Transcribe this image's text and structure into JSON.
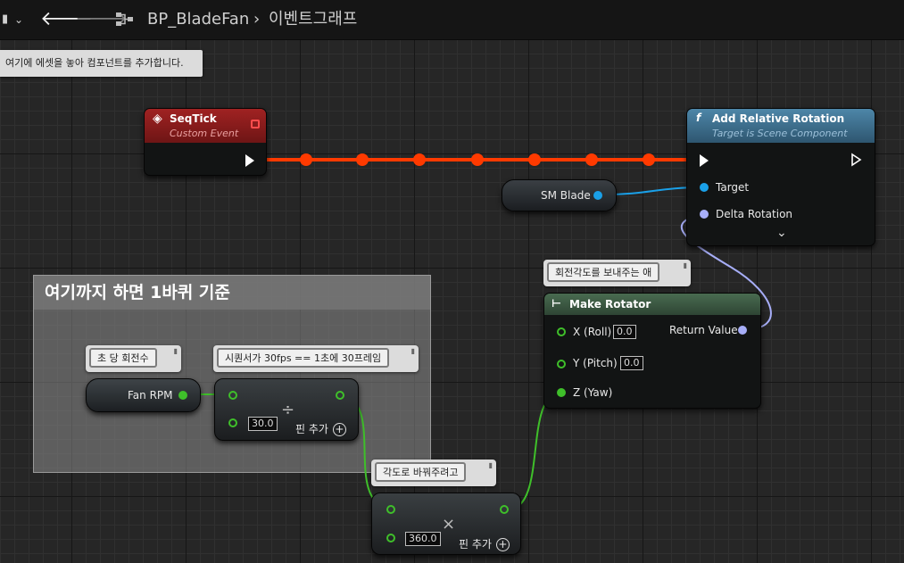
{
  "toolbar": {
    "blueprint_name": "BP_BladeFan",
    "graph_name": "이벤트그래프"
  },
  "tooltip": "여기에 에셋을 놓아 컴포넌트를 추가합니다.",
  "comment": {
    "title": "여기까지 하면 1바퀴 기준"
  },
  "nodes": {
    "seqtick": {
      "title": "SeqTick",
      "subtitle": "Custom Event"
    },
    "add_rotation": {
      "title": "Add Relative Rotation",
      "subtitle": "Target is Scene Component",
      "target_label": "Target",
      "delta_label": "Delta Rotation"
    },
    "sm_blade": {
      "label": "SM Blade"
    },
    "make_rotator": {
      "title": "Make Rotator",
      "comment": "회전각도를 보내주는 애",
      "x_label": "X (Roll)",
      "x_value": "0.0",
      "y_label": "Y (Pitch)",
      "y_value": "0.0",
      "z_label": "Z (Yaw)",
      "return_label": "Return Value"
    },
    "fan_rpm": {
      "label": "Fan RPM",
      "comment": "초 당 회전수"
    },
    "divide": {
      "comment": "시퀀서가 30fps == 1초에 30프레임",
      "operator": "÷",
      "value": "30.0",
      "add_pin": "핀 추가"
    },
    "multiply": {
      "comment": "각도로 바꿔주려고",
      "operator": "×",
      "value": "360.0",
      "add_pin": "핀 추가"
    }
  },
  "colors": {
    "event_header": "#8a1c1c",
    "function_header": "#3f6b86",
    "pure_header": "#3f5a46",
    "exec_wire": "#ff3a00",
    "object_pin": "#1aa0e8",
    "float_pin": "#3fbf2a",
    "rotator_pin": "#a7aef8"
  }
}
